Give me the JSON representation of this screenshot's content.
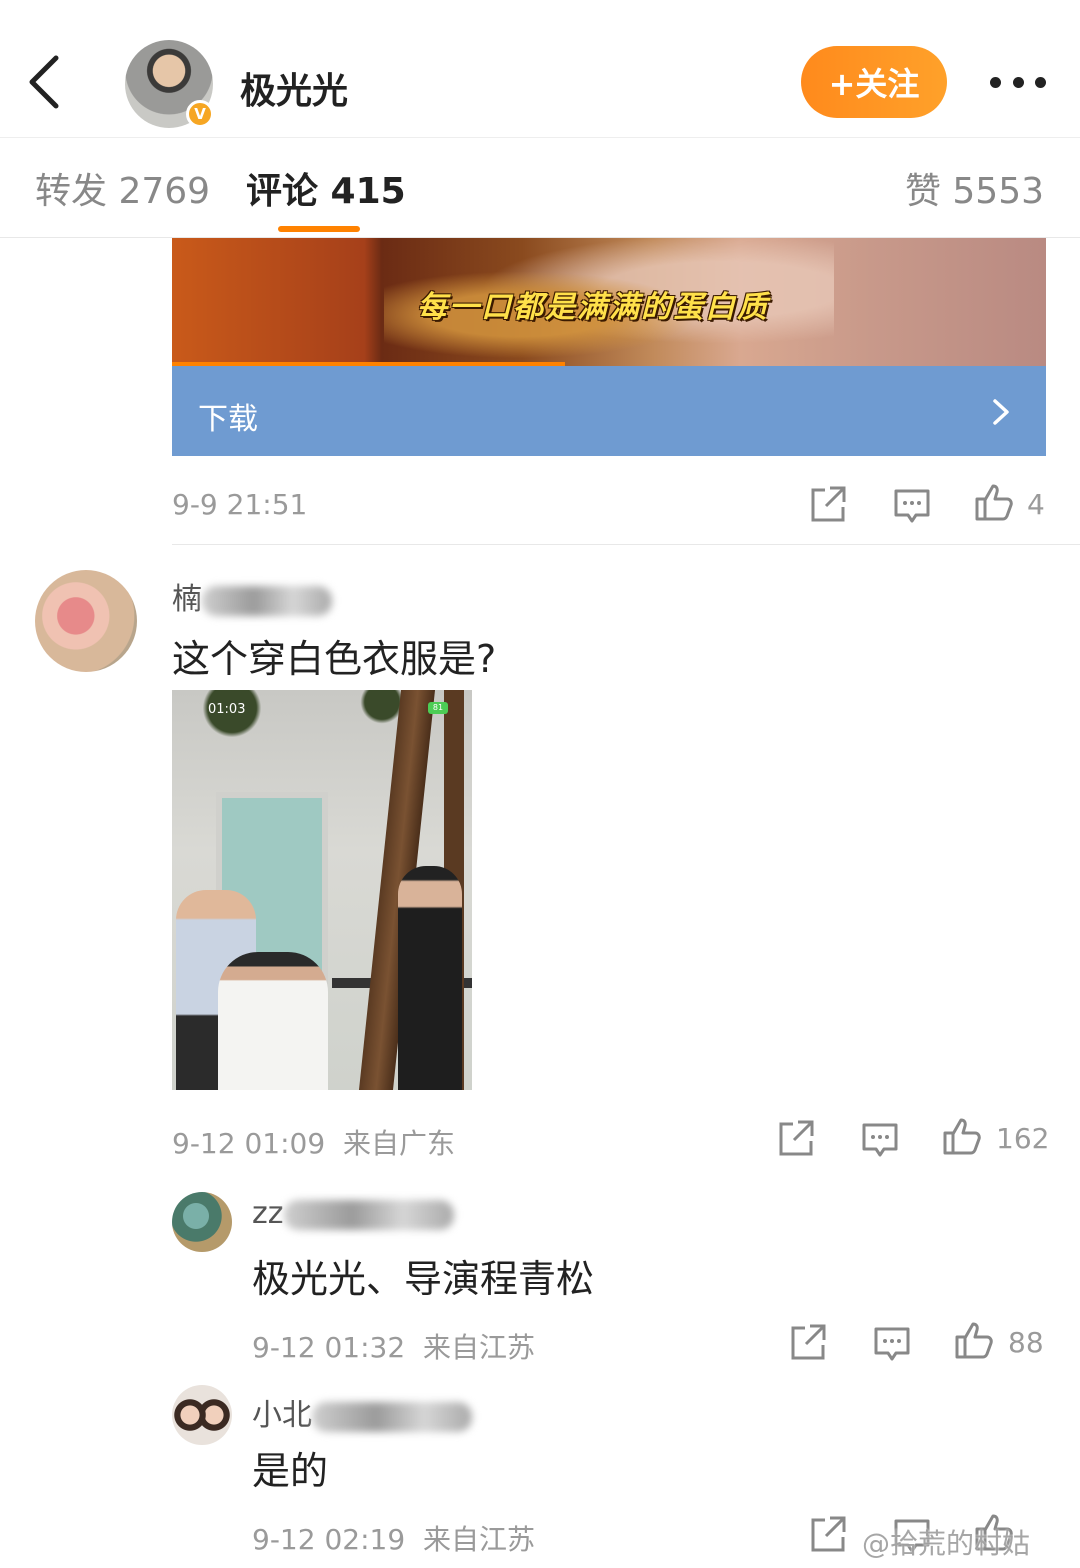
{
  "header": {
    "back_icon": "chevron-left-icon",
    "username": "极光光",
    "verified_badge": "V",
    "follow_label": "+关注",
    "more_icon": "more-dots-icon"
  },
  "tabs": [
    {
      "label": "转发 2769"
    },
    {
      "label": "评论 415"
    },
    {
      "label": "赞 5553"
    }
  ],
  "ad": {
    "caption": "每一口都是满满的蛋白质",
    "download_label": "下载",
    "progress_fraction": 0.45
  },
  "post_meta": {
    "time": "9-9 21:51",
    "like_count": "4"
  },
  "comments": [
    {
      "name_visible": "楠",
      "text": "这个穿白色衣服是?",
      "photo_status_time": "01:03",
      "photo_battery": "81",
      "time": "9-12 01:09",
      "location": "来自广东",
      "like_count": "162"
    },
    {
      "name_visible": "zz",
      "text": "极光光、导演程青松",
      "time": "9-12 01:32",
      "location": "来自江苏",
      "like_count": "88"
    },
    {
      "name_visible": "小北",
      "text": "是的",
      "time": "9-12 02:19",
      "location": "来自江苏"
    }
  ],
  "watermark": "@拾荒的村姑",
  "colors": {
    "accent": "#ff8200",
    "download_bar": "#6f9bd1",
    "meta_gray": "#9a9a9a"
  }
}
